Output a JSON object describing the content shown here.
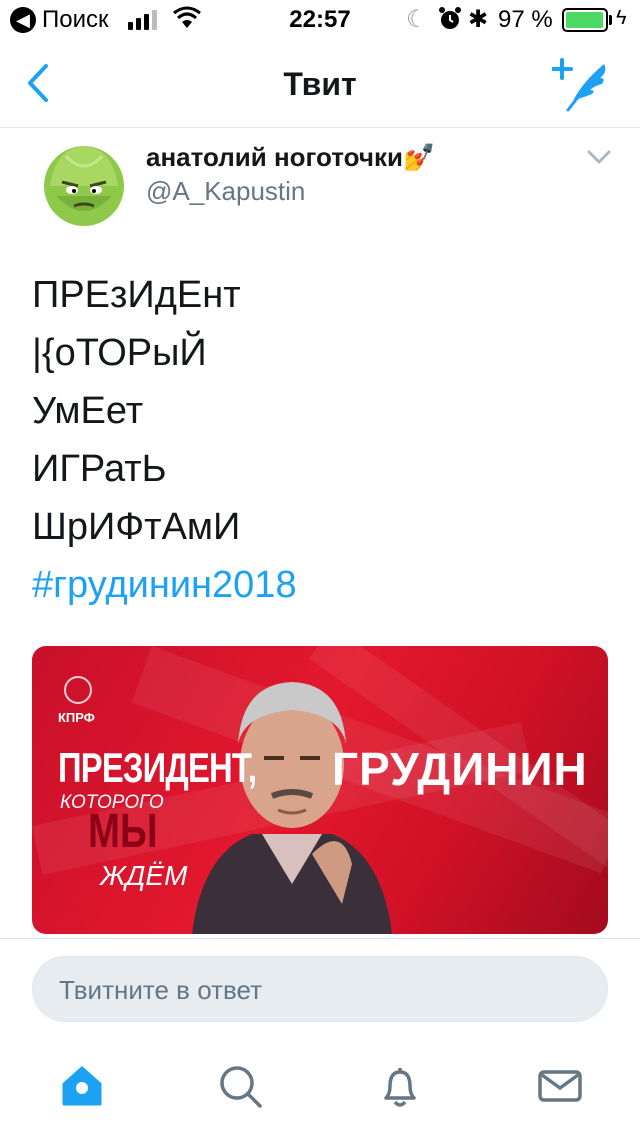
{
  "status_bar": {
    "back_label": "Поиск",
    "time": "22:57",
    "battery_percent": "97 %",
    "battery_level": 0.97
  },
  "nav": {
    "title": "Твит",
    "back_icon": "chevron-left-icon",
    "compose_icon": "compose-tweet-icon"
  },
  "tweet": {
    "author_name": "анатолий ноготочки💅",
    "author_handle": "@A_Kapustin",
    "lines": [
      "ПРЕзИдЕнт",
      "|{оТОРыЙ",
      "УмЕет",
      "ИГРатЬ",
      "ШрИФтАмИ"
    ],
    "hashtag": "#грудинин2018"
  },
  "media": {
    "party_label": "КПРФ",
    "line1": "ПРЕЗИДЕНТ,",
    "line2": "КОТОРОГО",
    "line3": "МЫ",
    "line4": "ЖДЁМ",
    "name": "ГРУДИНИН"
  },
  "reply": {
    "placeholder": "Твитните в ответ"
  },
  "tab_bar": {
    "items": [
      "home-icon",
      "search-icon",
      "notifications-icon",
      "messages-icon"
    ],
    "accent": "#1da1f2",
    "inactive": "#657786"
  }
}
